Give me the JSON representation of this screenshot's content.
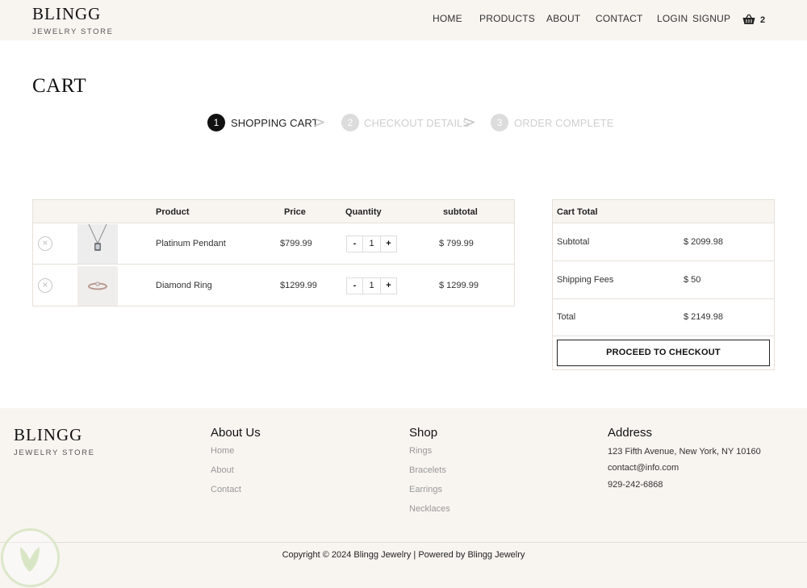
{
  "header": {
    "brand": "BLINGG",
    "brand_sub": "JEWELRY STORE",
    "nav": [
      "HOME",
      "PRODUCTS",
      "ABOUT",
      "CONTACT"
    ],
    "login": "LOGIN",
    "signup": "SIGNUP",
    "cart_count": "2",
    "cart_icon": "basket-icon"
  },
  "page": {
    "title": "CART",
    "steps": [
      {
        "num": "1",
        "label": "SHOPPING CART",
        "active": true
      },
      {
        "num": "2",
        "label": "CHECKOUT DETAILS",
        "active": false
      },
      {
        "num": "3",
        "label": "ORDER COMPLETE",
        "active": false
      }
    ],
    "step_separator": ">"
  },
  "cart": {
    "columns": [
      "Product",
      "Price",
      "Quantity",
      "subtotal"
    ],
    "rows": [
      {
        "name": "Platinum Pendant",
        "price": "$799.99",
        "qty": "1",
        "subtotal": "$  799.99",
        "image": "pendant-image"
      },
      {
        "name": "Diamond Ring",
        "price": "$1299.99",
        "qty": "1",
        "subtotal": "$  1299.99",
        "image": "ring-image"
      }
    ],
    "minus": "-",
    "plus": "+",
    "remove_icon": "remove-circle-icon",
    "remove_glyph": "×"
  },
  "totals": {
    "title": "Cart Total",
    "subtotal_label": "Subtotal",
    "subtotal_value": "$ 2099.98",
    "shipping_label": "Shipping Fees",
    "shipping_value": "$ 50",
    "total_label": "Total",
    "total_value": "$ 2149.98",
    "checkout_button": "PROCEED TO CHECKOUT"
  },
  "footer": {
    "brand": "BLINGG",
    "brand_sub": "JEWELRY STORE",
    "about_title": "About Us",
    "about_links": [
      "Home",
      "About",
      "Contact"
    ],
    "shop_title": "Shop",
    "shop_links": [
      "Rings",
      "Bracelets",
      "Earrings",
      "Necklaces"
    ],
    "address_title": "Address",
    "address_lines": [
      "123 Fifth Avenue, New York, NY 10160",
      "contact@info.com",
      "929-242-6868"
    ],
    "copyright": "Copyright © 2024 Blingg Jewelry | Powered by Blingg Jewelry"
  },
  "colors": {
    "bar_background": "#f8f5f1",
    "active_step": "#111111",
    "inactive_step": "#dcdcdc",
    "border": "#e6e0d9"
  }
}
